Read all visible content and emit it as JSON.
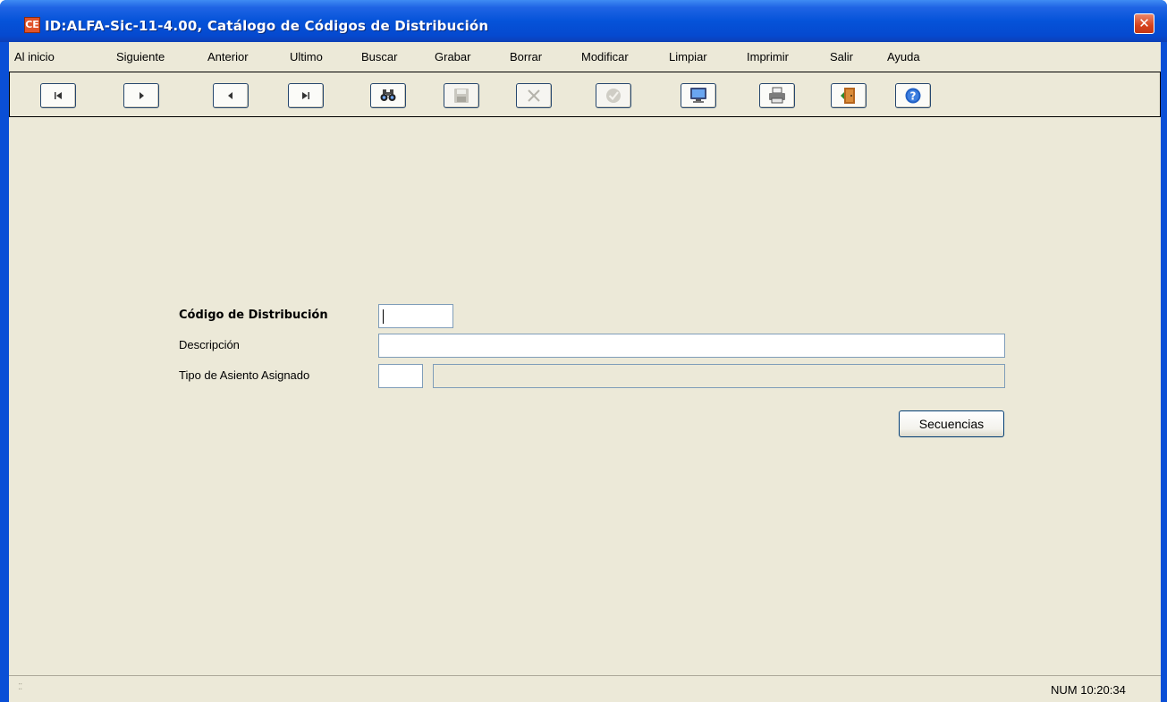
{
  "window": {
    "title": "ID:ALFA-Sic-11-4.00,  Catálogo de Códigos de Distribución",
    "app_icon": "CE",
    "close_glyph": "✕"
  },
  "menu": {
    "items": [
      "Al inicio",
      "Siguiente",
      "Anterior",
      "Ultimo",
      "Buscar",
      "Grabar",
      "Borrar",
      "Modificar",
      "Limpiar",
      "Imprimir",
      "Salir",
      "Ayuda"
    ]
  },
  "toolbar": {
    "buttons": [
      {
        "icon": "first-record-icon",
        "enabled": true
      },
      {
        "icon": "next-record-icon",
        "enabled": true
      },
      {
        "icon": "previous-record-icon",
        "enabled": true
      },
      {
        "icon": "last-record-icon",
        "enabled": true
      },
      {
        "icon": "binoculars-icon",
        "enabled": true
      },
      {
        "icon": "floppy-disk-icon",
        "enabled": false
      },
      {
        "icon": "delete-x-icon",
        "enabled": false
      },
      {
        "icon": "checkmark-icon",
        "enabled": false
      },
      {
        "icon": "monitor-icon",
        "enabled": true
      },
      {
        "icon": "printer-icon",
        "enabled": true
      },
      {
        "icon": "exit-door-icon",
        "enabled": true
      },
      {
        "icon": "help-icon",
        "enabled": true
      }
    ]
  },
  "form": {
    "codigo_label": "Código de Distribución",
    "codigo_value": "",
    "descripcion_label": "Descripción",
    "descripcion_value": "",
    "tipo_label": "Tipo de Asiento Asignado",
    "tipo_value": "",
    "tipo_desc_value": "",
    "secuencias_label": "Secuencias"
  },
  "status": {
    "text": "NUM  10:20:34"
  },
  "colors": {
    "title_blue": "#0553d9",
    "client_bg": "#ece9d8",
    "close_red": "#d6421c"
  }
}
